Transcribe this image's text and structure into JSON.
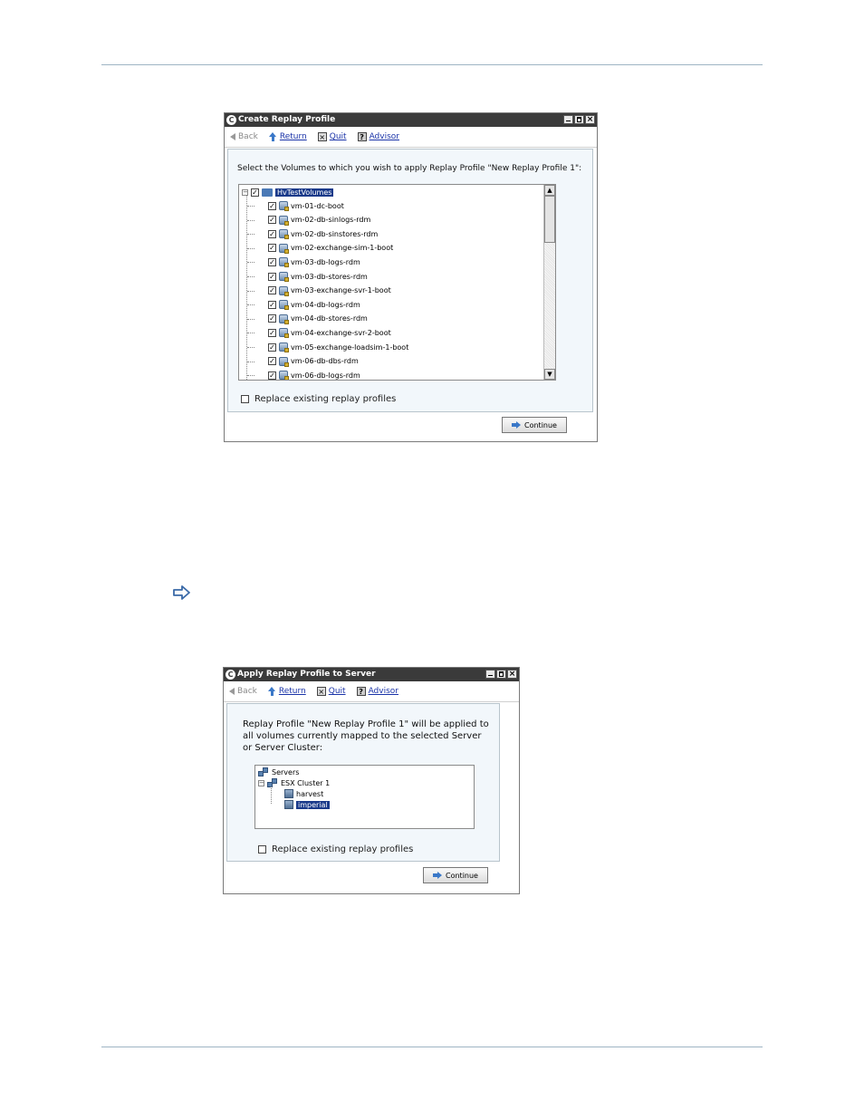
{
  "dialog1": {
    "title": "Create Replay Profile",
    "toolbar": {
      "back": "Back",
      "return": "Return",
      "quit": "Quit",
      "advisor": "Advisor"
    },
    "prompt": "Select the Volumes to which you wish to apply Replay Profile \"New Replay Profile 1\":",
    "root": "HvTestVolumes",
    "volumes": [
      "vm-01-dc-boot",
      "vm-02-db-sinlogs-rdm",
      "vm-02-db-sinstores-rdm",
      "vm-02-exchange-sim-1-boot",
      "vm-03-db-logs-rdm",
      "vm-03-db-stores-rdm",
      "vm-03-exchange-svr-1-boot",
      "vm-04-db-logs-rdm",
      "vm-04-db-stores-rdm",
      "vm-04-exchange-svr-2-boot",
      "vm-05-exchange-loadsim-1-boot",
      "vm-06-db-dbs-rdm",
      "vm-06-db-logs-rdm"
    ],
    "replace_label": "Replace existing replay profiles",
    "continue_label": "Continue"
  },
  "dialog2": {
    "title": "Apply Replay Profile to Server",
    "toolbar": {
      "back": "Back",
      "return": "Return",
      "quit": "Quit",
      "advisor": "Advisor"
    },
    "prompt_line1": "Replay Profile \"New Replay Profile 1\" will be applied to",
    "prompt_line2": "all volumes currently mapped to the selected Server",
    "prompt_line3": "or Server Cluster:",
    "tree": {
      "root": "Servers",
      "cluster": "ESX Cluster 1",
      "servers": [
        "harvest",
        "imperial"
      ]
    },
    "replace_label": "Replace existing replay profiles",
    "continue_label": "Continue"
  },
  "colors": {
    "rule": "#9fb4c4",
    "titlebar": "#3a3a3a",
    "selection": "#1a3a8a",
    "link": "#1a33a8",
    "accent_arrow": "#3a78c8"
  }
}
